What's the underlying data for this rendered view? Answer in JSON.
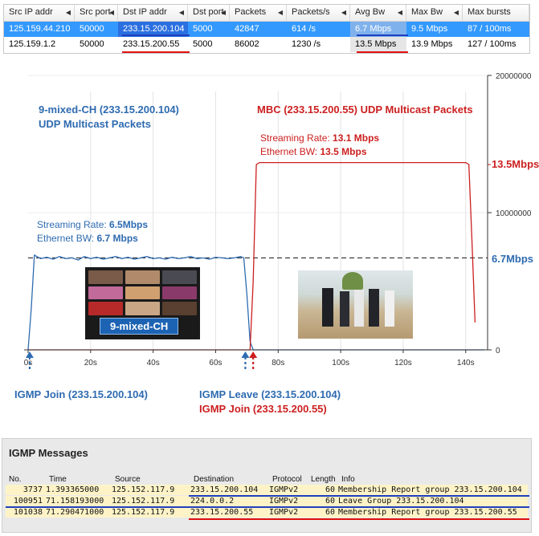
{
  "colors": {
    "blue": "#2e6bb0",
    "red": "#cc1f1f",
    "selected": "#3399ff",
    "highlight": "#fdf3c7"
  },
  "flow_table": {
    "columns": [
      "Src IP addr",
      "Src port",
      "Dst IP addr",
      "Dst port",
      "Packets",
      "Packets/s",
      "Avg Bw",
      "Max Bw",
      "Max bursts"
    ],
    "rows": [
      [
        "125.159.44.210",
        "50000",
        "233.15.200.104",
        "5000",
        "42847",
        "614 /s",
        "6.7 Mbps",
        "9.5 Mbps",
        "87 / 100ms"
      ],
      [
        "125.159.1.2",
        "50000",
        "233.15.200.55",
        "5000",
        "86002",
        "1230 /s",
        "13.5 Mbps",
        "13.9 Mbps",
        "127 / 100ms"
      ]
    ]
  },
  "chart": {
    "left_title_1": "9-mixed-CH (233.15.200.104)",
    "left_title_2": "UDP Multicast Packets",
    "right_title": "MBC (233.15.200.55) UDP Multicast Packets",
    "blue_rate_label": "Streaming Rate: ",
    "blue_rate_value": "6.5Mbps",
    "blue_bw_label": "Ethernet BW: ",
    "blue_bw_value": "6.7 Mbps",
    "red_rate_label": "Streaming Rate: ",
    "red_rate_value": "13.1 Mbps",
    "red_bw_label": "Ethernet BW: ",
    "red_bw_value": "13.5 Mbps",
    "ref_high": "13.5Mbps",
    "ref_low": "6.7Mbps",
    "thumb_label": "9-mixed-CH",
    "event_join_blue": "IGMP Join (233.15.200.104)",
    "event_leave_blue": "IGMP Leave (233.15.200.104)",
    "event_join_red": "IGMP Join (233.15.200.55)"
  },
  "chart_data": {
    "type": "line",
    "xlim": [
      0,
      147
    ],
    "ylim": [
      0,
      20000000
    ],
    "x_ticks": [
      "0s",
      "20s",
      "40s",
      "60s",
      "80s",
      "100s",
      "120s",
      "140s"
    ],
    "x_tick_values": [
      0,
      20,
      40,
      60,
      80,
      100,
      120,
      140
    ],
    "y_ticks": [
      "0",
      "10000000",
      "20000000"
    ],
    "y_tick_values": [
      0,
      10000000,
      20000000
    ],
    "reference_lines": [
      6700000,
      13500000
    ],
    "series": [
      {
        "color": "#2e6bb0",
        "x": [
          0,
          1,
          2,
          4,
          6,
          8,
          10,
          12,
          14,
          16,
          18,
          20,
          22,
          24,
          26,
          28,
          30,
          32,
          34,
          36,
          38,
          40,
          42,
          44,
          46,
          48,
          50,
          52,
          54,
          56,
          58,
          60,
          62,
          64,
          66,
          68,
          69,
          70,
          71,
          72,
          146
        ],
        "y": [
          0,
          3000000,
          6900000,
          6650000,
          6750000,
          6600000,
          6800000,
          6650000,
          6700000,
          6550000,
          6800000,
          6650000,
          6750000,
          6600000,
          6700000,
          6800000,
          6650000,
          6750000,
          6600000,
          6700000,
          6800000,
          6650000,
          6700000,
          6600000,
          6750000,
          6650000,
          6700000,
          6800000,
          6650000,
          6700000,
          6600000,
          6750000,
          6700000,
          6650000,
          6700000,
          6800000,
          6700000,
          4000000,
          600000,
          0,
          0
        ]
      },
      {
        "color": "#cc1f1f",
        "x": [
          0,
          71,
          72,
          73,
          74,
          140,
          141,
          142,
          143
        ],
        "y": [
          0,
          0,
          5000000,
          13500000,
          13650000,
          13650000,
          13500000,
          8000000,
          2000000
        ]
      }
    ]
  },
  "igmp": {
    "title": "IGMP Messages",
    "columns": [
      "No.",
      "Time",
      "Source",
      "Destination",
      "Protocol",
      "Length",
      "Info"
    ],
    "rows": [
      [
        "3737",
        "1.393365000",
        "125.152.117.9",
        "233.15.200.104",
        "IGMPv2",
        "60",
        "Membership Report group 233.15.200.104"
      ],
      [
        "100951",
        "71.158193000",
        "125.152.117.9",
        "224.0.0.2",
        "IGMPv2",
        "60",
        "Leave Group 233.15.200.104"
      ],
      [
        "101038",
        "71.290471000",
        "125.152.117.9",
        "233.15.200.55",
        "IGMPv2",
        "60",
        "Membership Report group 233.15.200.55"
      ]
    ]
  }
}
